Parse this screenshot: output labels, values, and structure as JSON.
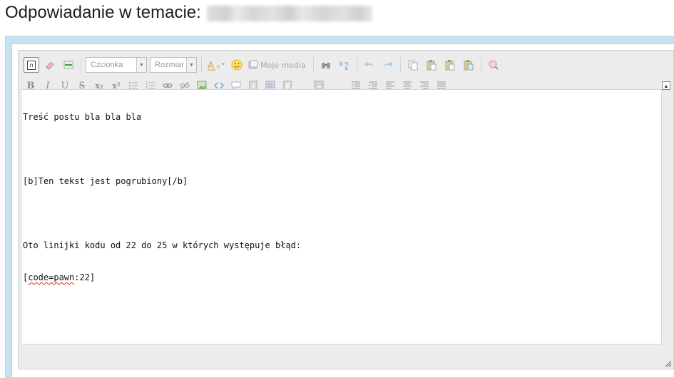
{
  "page": {
    "title": "Odpowiadanie w temacie:"
  },
  "toolbar": {
    "row1": {
      "source_icon_text": "n",
      "font_combo": "Czcionka",
      "size_combo": "Rozmiar",
      "media_label": "Moje media"
    },
    "row2": {
      "bold": "B",
      "italic": "I",
      "underline": "U",
      "strike": "S",
      "subscript": "x₂",
      "superscript": "x²"
    }
  },
  "editor": {
    "lines": [
      "Treść postu bla bla bla",
      "",
      "[b]Ten tekst jest pogrubiony[/b]",
      "",
      "Oto linijki kodu od 22 do 25 w których występuje błąd:"
    ],
    "last_line": {
      "prefix": "[",
      "misspelled": "code=pawn",
      "suffix": ":22]"
    }
  },
  "colors": {
    "frame": "#c7e3ef",
    "toolbar_bg": "#ececec"
  }
}
